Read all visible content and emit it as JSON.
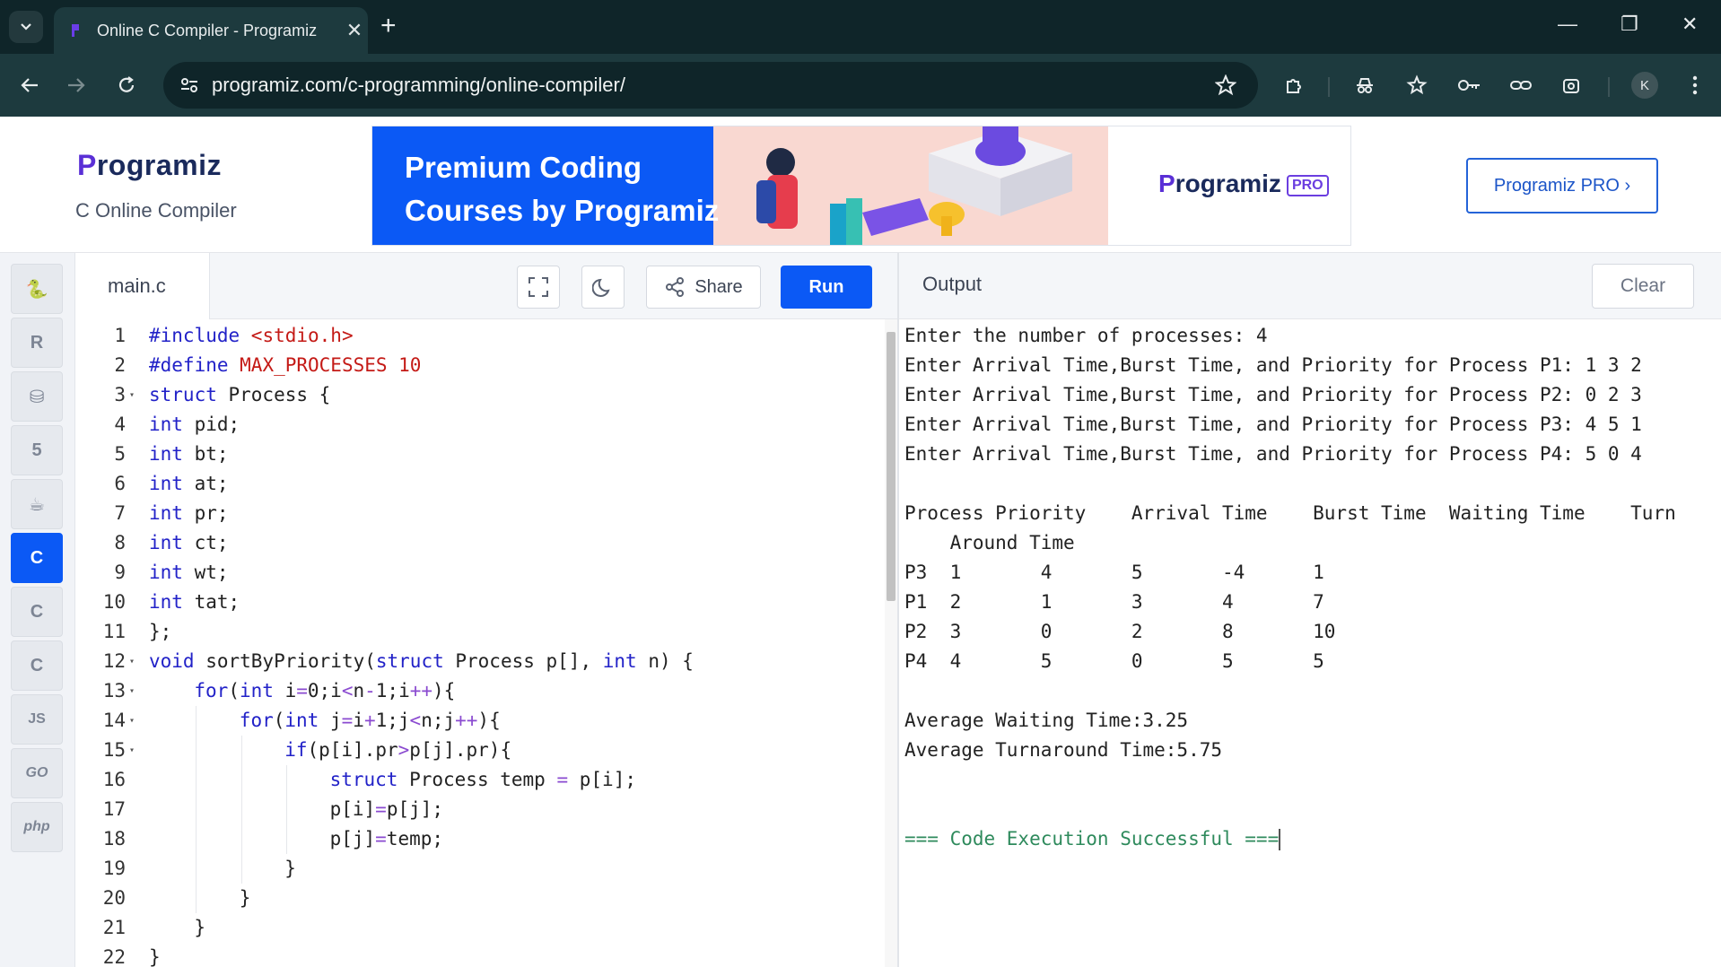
{
  "browser": {
    "tab_title": "Online C Compiler - Programiz",
    "url": "programiz.com/c-programming/online-compiler/",
    "profile_initial": "K"
  },
  "header": {
    "logo_text": "Programiz",
    "subtitle": "C Online Compiler",
    "banner_text_line1": "Premium Coding",
    "banner_text_line2": "Courses by Programiz",
    "banner_logo": "Programiz",
    "banner_pro_badge": "PRO",
    "pro_button_label": "Programiz PRO ›"
  },
  "sidebar": {
    "languages": [
      {
        "name": "python",
        "glyph": "🐍",
        "active": false
      },
      {
        "name": "r",
        "glyph": "R",
        "active": false
      },
      {
        "name": "sql",
        "glyph": "⛁",
        "active": false
      },
      {
        "name": "html",
        "glyph": "5",
        "active": false
      },
      {
        "name": "java",
        "glyph": "☕",
        "active": false
      },
      {
        "name": "c",
        "glyph": "C",
        "active": true
      },
      {
        "name": "cpp",
        "glyph": "C",
        "active": false
      },
      {
        "name": "csharp",
        "glyph": "C",
        "active": false
      },
      {
        "name": "javascript",
        "glyph": "JS",
        "active": false
      },
      {
        "name": "go",
        "glyph": "GO",
        "active": false
      },
      {
        "name": "php",
        "glyph": "php",
        "active": false
      }
    ]
  },
  "editor": {
    "file_name": "main.c",
    "share_label": "Share",
    "run_label": "Run",
    "lines": [
      {
        "n": "1",
        "fold": false,
        "indent": 0,
        "tokens": [
          [
            "pp",
            "#include "
          ],
          [
            "str",
            "<stdio.h>"
          ]
        ]
      },
      {
        "n": "2",
        "fold": false,
        "indent": 0,
        "tokens": [
          [
            "pp",
            "#define "
          ],
          [
            "str",
            "MAX_PROCESSES 10"
          ]
        ]
      },
      {
        "n": "3",
        "fold": true,
        "indent": 0,
        "tokens": [
          [
            "kw",
            "struct"
          ],
          [
            "t",
            " Process {"
          ]
        ]
      },
      {
        "n": "4",
        "fold": false,
        "indent": 0,
        "tokens": [
          [
            "kw",
            "int"
          ],
          [
            "t",
            " pid;"
          ]
        ]
      },
      {
        "n": "5",
        "fold": false,
        "indent": 0,
        "tokens": [
          [
            "kw",
            "int"
          ],
          [
            "t",
            " bt;"
          ]
        ]
      },
      {
        "n": "6",
        "fold": false,
        "indent": 0,
        "tokens": [
          [
            "kw",
            "int"
          ],
          [
            "t",
            " at;"
          ]
        ]
      },
      {
        "n": "7",
        "fold": false,
        "indent": 0,
        "tokens": [
          [
            "kw",
            "int"
          ],
          [
            "t",
            " pr;"
          ]
        ]
      },
      {
        "n": "8",
        "fold": false,
        "indent": 0,
        "tokens": [
          [
            "kw",
            "int"
          ],
          [
            "t",
            " ct;"
          ]
        ]
      },
      {
        "n": "9",
        "fold": false,
        "indent": 0,
        "tokens": [
          [
            "kw",
            "int"
          ],
          [
            "t",
            " wt;"
          ]
        ]
      },
      {
        "n": "10",
        "fold": false,
        "indent": 0,
        "tokens": [
          [
            "kw",
            "int"
          ],
          [
            "t",
            " tat;"
          ]
        ]
      },
      {
        "n": "11",
        "fold": false,
        "indent": 0,
        "tokens": [
          [
            "t",
            "};"
          ]
        ]
      },
      {
        "n": "12",
        "fold": true,
        "indent": 0,
        "tokens": [
          [
            "kw",
            "void"
          ],
          [
            "t",
            " sortByPriority("
          ],
          [
            "kw",
            "struct"
          ],
          [
            "t",
            " Process p[], "
          ],
          [
            "kw",
            "int"
          ],
          [
            "t",
            " n) {"
          ]
        ]
      },
      {
        "n": "13",
        "fold": true,
        "indent": 1,
        "tokens": [
          [
            "kw",
            "for"
          ],
          [
            "t",
            "("
          ],
          [
            "kw",
            "int"
          ],
          [
            "t",
            " i"
          ],
          [
            "op",
            "="
          ],
          [
            "t",
            "0;i"
          ],
          [
            "op",
            "<"
          ],
          [
            "t",
            "n"
          ],
          [
            "op",
            "-"
          ],
          [
            "t",
            "1;i"
          ],
          [
            "op",
            "++"
          ],
          [
            "t",
            "){"
          ]
        ]
      },
      {
        "n": "14",
        "fold": true,
        "indent": 2,
        "tokens": [
          [
            "kw",
            "for"
          ],
          [
            "t",
            "("
          ],
          [
            "kw",
            "int"
          ],
          [
            "t",
            " j"
          ],
          [
            "op",
            "="
          ],
          [
            "t",
            "i"
          ],
          [
            "op",
            "+"
          ],
          [
            "t",
            "1;j"
          ],
          [
            "op",
            "<"
          ],
          [
            "t",
            "n;j"
          ],
          [
            "op",
            "++"
          ],
          [
            "t",
            "){"
          ]
        ]
      },
      {
        "n": "15",
        "fold": true,
        "indent": 3,
        "tokens": [
          [
            "kw",
            "if"
          ],
          [
            "t",
            "(p[i].pr"
          ],
          [
            "op",
            ">"
          ],
          [
            "t",
            "p[j].pr){"
          ]
        ]
      },
      {
        "n": "16",
        "fold": false,
        "indent": 4,
        "tokens": [
          [
            "kw",
            "struct"
          ],
          [
            "t",
            " Process temp "
          ],
          [
            "op",
            "="
          ],
          [
            "t",
            " p[i];"
          ]
        ]
      },
      {
        "n": "17",
        "fold": false,
        "indent": 4,
        "tokens": [
          [
            "t",
            "p[i]"
          ],
          [
            "op",
            "="
          ],
          [
            "t",
            "p[j];"
          ]
        ]
      },
      {
        "n": "18",
        "fold": false,
        "indent": 4,
        "tokens": [
          [
            "t",
            "p[j]"
          ],
          [
            "op",
            "="
          ],
          [
            "t",
            "temp;"
          ]
        ]
      },
      {
        "n": "19",
        "fold": false,
        "indent": 3,
        "tokens": [
          [
            "t",
            "}"
          ]
        ]
      },
      {
        "n": "20",
        "fold": false,
        "indent": 2,
        "tokens": [
          [
            "t",
            "}"
          ]
        ]
      },
      {
        "n": "21",
        "fold": false,
        "indent": 1,
        "tokens": [
          [
            "t",
            "}"
          ]
        ]
      },
      {
        "n": "22",
        "fold": false,
        "indent": 0,
        "tokens": [
          [
            "t",
            "}"
          ]
        ]
      }
    ]
  },
  "output": {
    "title": "Output",
    "clear_label": "Clear",
    "lines": [
      "Enter the number of processes: 4",
      "Enter Arrival Time,Burst Time, and Priority for Process P1: 1 3 2",
      "Enter Arrival Time,Burst Time, and Priority for Process P2: 0 2 3",
      "Enter Arrival Time,Burst Time, and Priority for Process P3: 4 5 1",
      "Enter Arrival Time,Burst Time, and Priority for Process P4: 5 0 4",
      "",
      "Process Priority    Arrival Time    Burst Time  Waiting Time    Turn",
      "    Around Time",
      "P3  1       4       5       -4      1",
      "P1  2       1       3       4       7",
      "P2  3       0       2       8       10",
      "P4  4       5       0       5       5",
      "",
      "Average Waiting Time:3.25",
      "Average Turnaround Time:5.75",
      "",
      "",
      "=== Code Execution Successful ==="
    ]
  }
}
